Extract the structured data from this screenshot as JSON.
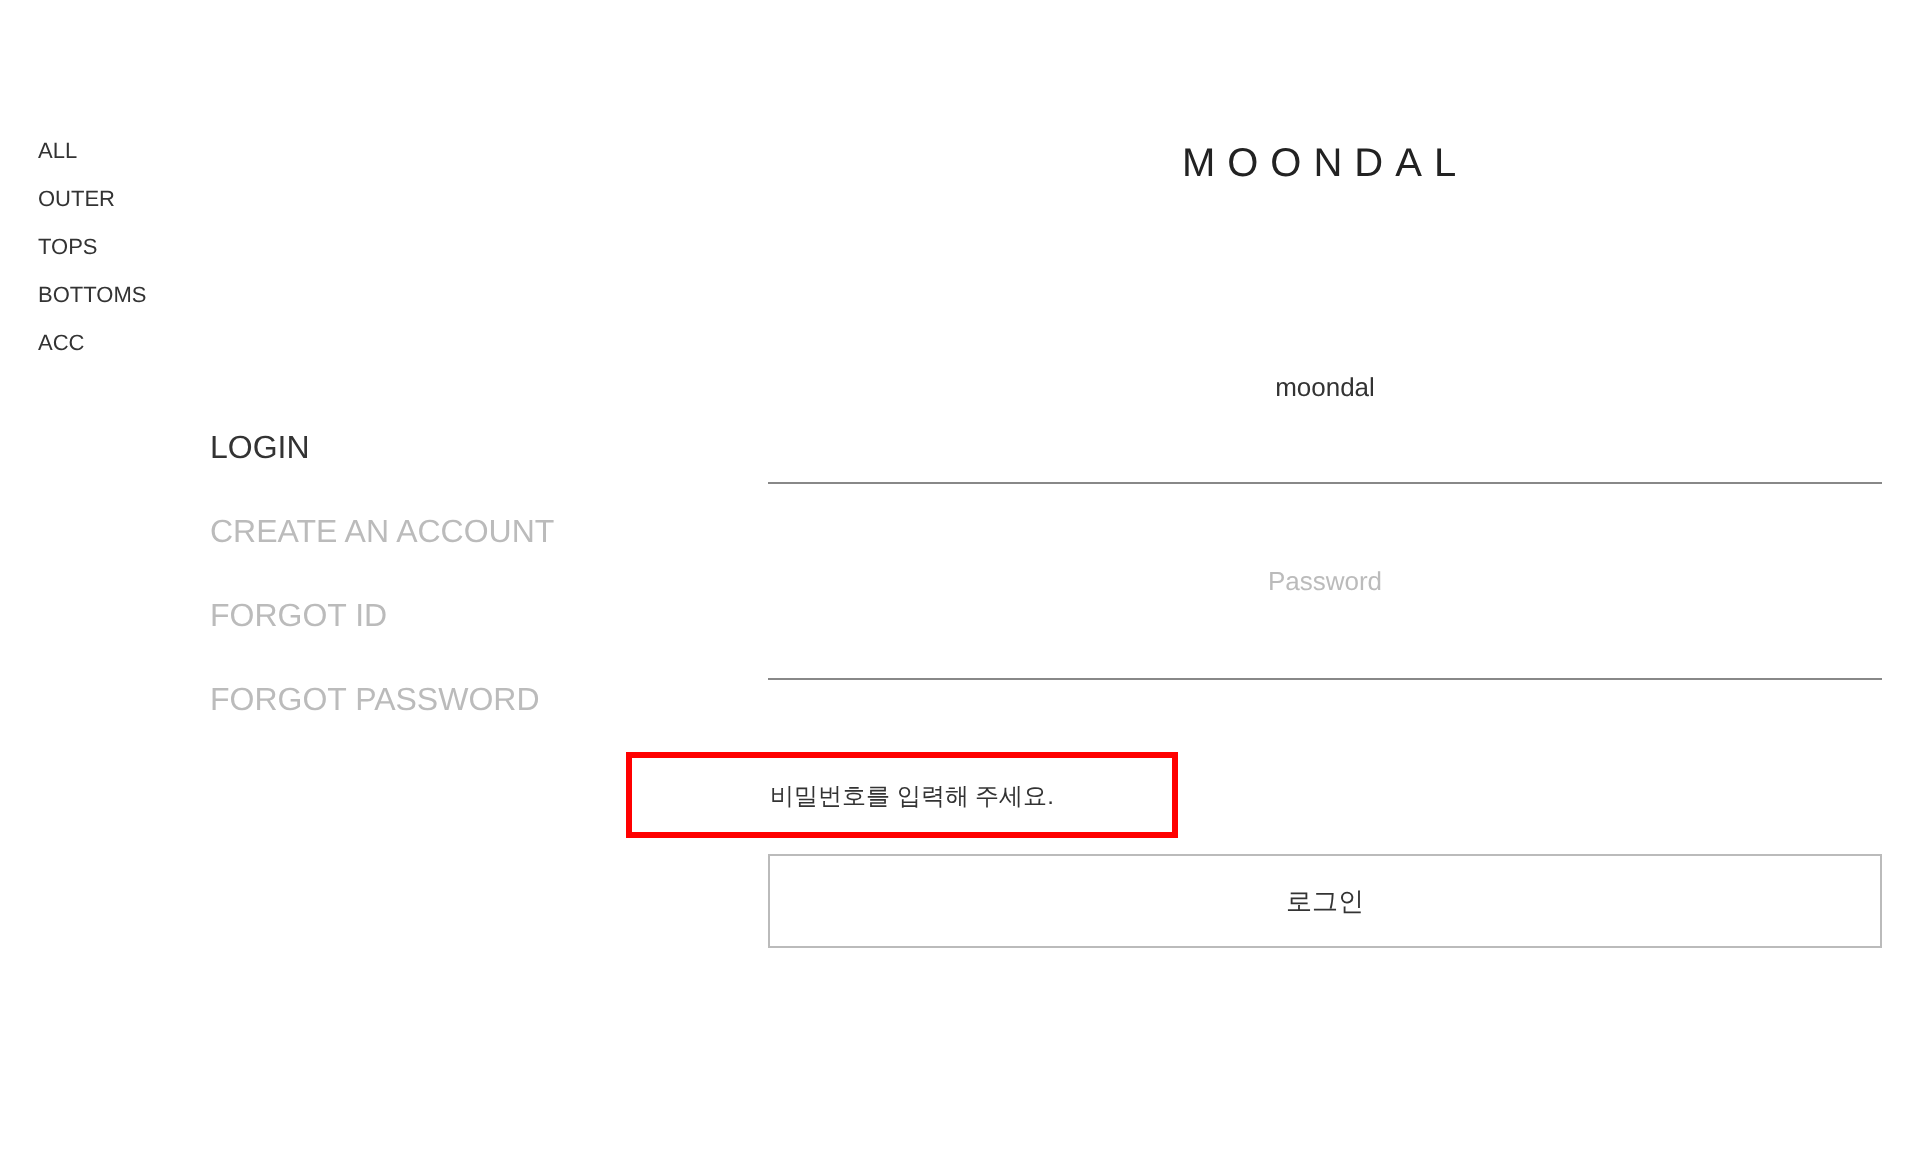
{
  "categories": [
    {
      "label": "ALL"
    },
    {
      "label": "OUTER"
    },
    {
      "label": "TOPS"
    },
    {
      "label": "BOTTOMS"
    },
    {
      "label": "ACC"
    }
  ],
  "logo": "MOONDAL",
  "account_menu": [
    {
      "label": "LOGIN",
      "selected": true
    },
    {
      "label": "CREATE AN ACCOUNT",
      "selected": false
    },
    {
      "label": "FORGOT ID",
      "selected": false
    },
    {
      "label": "FORGOT PASSWORD",
      "selected": false
    }
  ],
  "username_field": {
    "value": "moondal"
  },
  "password_field": {
    "placeholder": "Password"
  },
  "error_message": {
    "text": "비밀번호를 입력해 주세요.",
    "highlighted": true
  },
  "login_button": "로그인"
}
